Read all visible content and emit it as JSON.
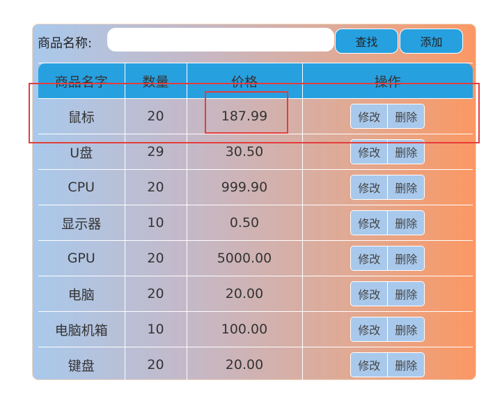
{
  "search": {
    "label": "商品名称:",
    "value": "",
    "placeholder": ""
  },
  "buttons": {
    "find": "查找",
    "add": "添加"
  },
  "table": {
    "headers": [
      "商品名字",
      "数量",
      "价格",
      "操作"
    ],
    "rows": [
      {
        "name": "鼠标",
        "qty": "20",
        "price": "187.99"
      },
      {
        "name": "U盘",
        "qty": "29",
        "price": "30.50"
      },
      {
        "name": "CPU",
        "qty": "20",
        "price": "999.90"
      },
      {
        "name": "显示器",
        "qty": "10",
        "price": "0.50"
      },
      {
        "name": "GPU",
        "qty": "20",
        "price": "5000.00"
      },
      {
        "name": "电脑",
        "qty": "20",
        "price": "20.00"
      },
      {
        "name": "电脑机箱",
        "qty": "10",
        "price": "100.00"
      },
      {
        "name": "键盘",
        "qty": "20",
        "price": "20.00"
      }
    ],
    "row_actions": {
      "edit": "修改",
      "delete": "删除"
    }
  },
  "colors": {
    "header": "#27a0e0",
    "highlight": "#e53b3b",
    "gradient_start": "#a9c9ec",
    "gradient_end": "#fb9864"
  }
}
